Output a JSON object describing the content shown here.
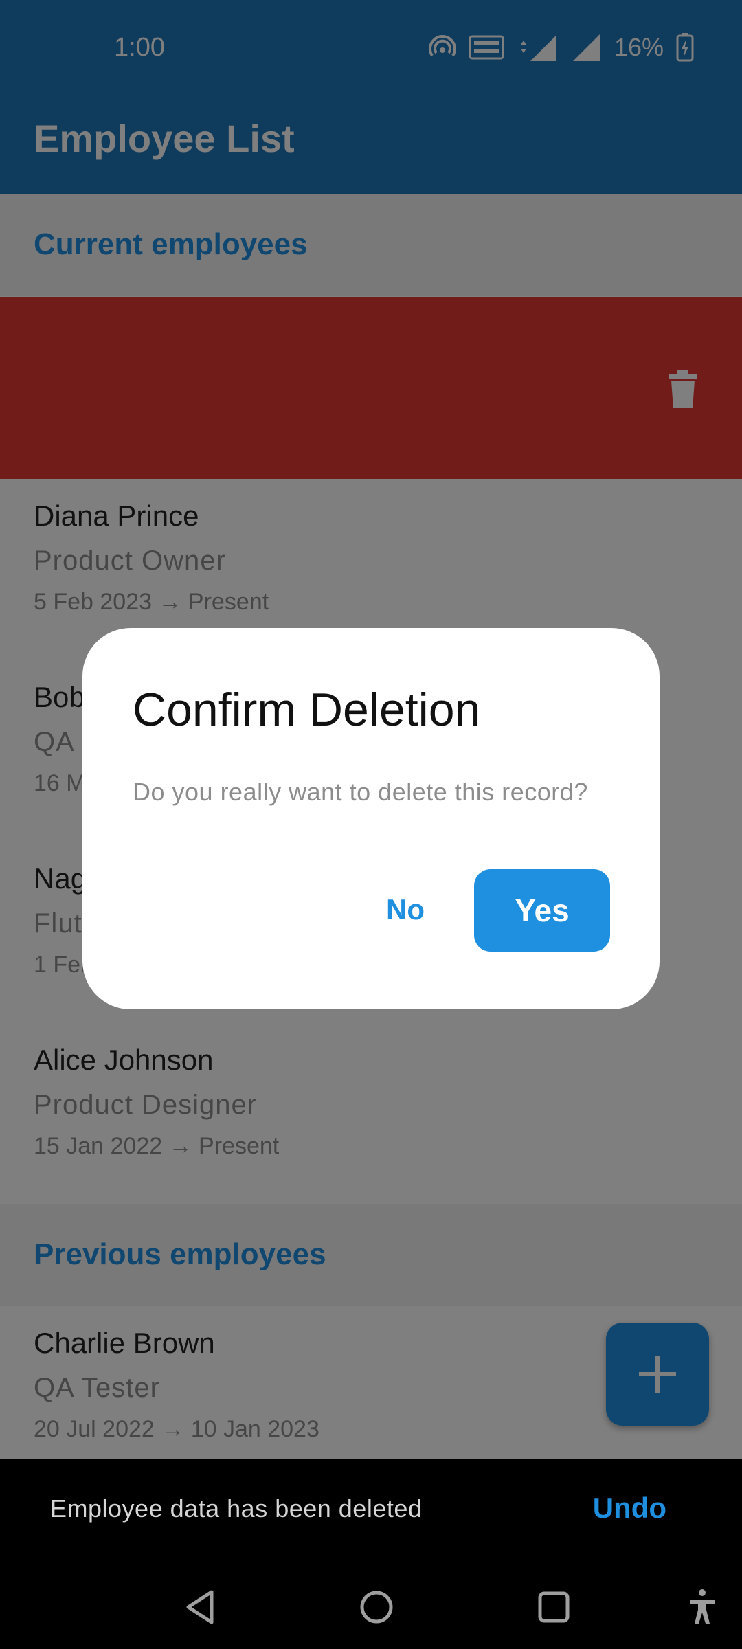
{
  "status_bar": {
    "time": "1:00",
    "battery": "16%",
    "icons": [
      "hotspot-icon",
      "volte-icon",
      "4g-signal-icon",
      "signal-icon",
      "battery-charging-icon"
    ]
  },
  "app_bar": {
    "title": "Employee List"
  },
  "sections": {
    "current": "Current employees",
    "previous": "Previous employees"
  },
  "current_employees": [
    {
      "name": "Diana Prince",
      "role": "Product Owner",
      "dates": "5 Feb 2023 → Present"
    },
    {
      "name": "Bob",
      "role": "QA",
      "dates": "16 M"
    },
    {
      "name": "Nag",
      "role": "Flut",
      "dates": "1 Feb"
    },
    {
      "name": "Alice Johnson",
      "role": "Product Designer",
      "dates": "15 Jan 2022 → Present"
    }
  ],
  "previous_employees": [
    {
      "name": "Charlie Brown",
      "role": "QA Tester",
      "dates": "20 Jul 2022 → 10 Jan 2023"
    }
  ],
  "swipe_action": {
    "icon": "trash-icon",
    "color": "#e53935"
  },
  "fab": {
    "icon": "plus-icon"
  },
  "dialog": {
    "title": "Confirm Deletion",
    "message": "Do you really want to delete this record?",
    "no_label": "No",
    "yes_label": "Yes"
  },
  "snackbar": {
    "message": "Employee data has been deleted",
    "action": "Undo"
  },
  "nav": [
    "back-icon",
    "home-icon",
    "recents-icon",
    "accessibility-icon"
  ],
  "colors": {
    "primary": "#1f76ba",
    "accent": "#1f8fe0",
    "danger": "#e53935"
  }
}
